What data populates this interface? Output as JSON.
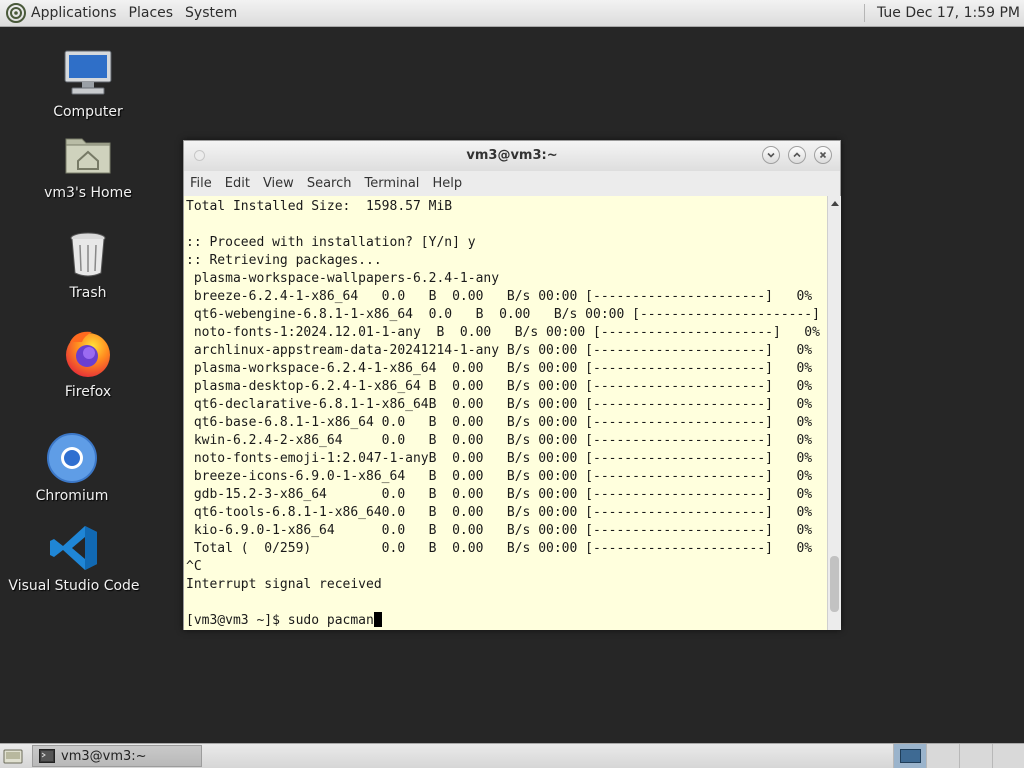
{
  "top_panel": {
    "menus": [
      "Applications",
      "Places",
      "System"
    ],
    "clock": "Tue Dec 17,  1:59 PM"
  },
  "desktop_icons": [
    {
      "label": "Computer",
      "icon": "computer-icon"
    },
    {
      "label": "vm3's Home",
      "icon": "home-folder-icon"
    },
    {
      "label": "Trash",
      "icon": "trash-icon"
    },
    {
      "label": "Firefox",
      "icon": "firefox-icon"
    },
    {
      "label": "Chromium",
      "icon": "chromium-icon"
    },
    {
      "label": "Visual Studio Code",
      "icon": "vscode-icon"
    }
  ],
  "terminal": {
    "title": "vm3@vm3:~",
    "menus": [
      "File",
      "Edit",
      "View",
      "Search",
      "Terminal",
      "Help"
    ],
    "lines": [
      "Total Installed Size:  1598.57 MiB",
      "",
      ":: Proceed with installation? [Y/n] y",
      ":: Retrieving packages...",
      " plasma-workspace-wallpapers-6.2.4-1-any",
      " breeze-6.2.4-1-x86_64   0.0   B  0.00   B/s 00:00 [----------------------]   0%",
      " qt6-webengine-6.8.1-1-x86_64  0.0   B  0.00   B/s 00:00 [----------------------]   0%",
      " noto-fonts-1:2024.12.01-1-any  B  0.00   B/s 00:00 [----------------------]   0%",
      " archlinux-appstream-data-20241214-1-any B/s 00:00 [----------------------]   0%",
      " plasma-workspace-6.2.4-1-x86_64  0.00   B/s 00:00 [----------------------]   0%",
      " plasma-desktop-6.2.4-1-x86_64 B  0.00   B/s 00:00 [----------------------]   0%",
      " qt6-declarative-6.8.1-1-x86_64B  0.00   B/s 00:00 [----------------------]   0%",
      " qt6-base-6.8.1-1-x86_64 0.0   B  0.00   B/s 00:00 [----------------------]   0%",
      " kwin-6.2.4-2-x86_64     0.0   B  0.00   B/s 00:00 [----------------------]   0%",
      " noto-fonts-emoji-1:2.047-1-anyB  0.00   B/s 00:00 [----------------------]   0%",
      " breeze-icons-6.9.0-1-x86_64   B  0.00   B/s 00:00 [----------------------]   0%",
      " gdb-15.2-3-x86_64       0.0   B  0.00   B/s 00:00 [----------------------]   0%",
      " qt6-tools-6.8.1-1-x86_640.0   B  0.00   B/s 00:00 [----------------------]   0%",
      " kio-6.9.0-1-x86_64      0.0   B  0.00   B/s 00:00 [----------------------]   0%",
      " Total (  0/259)         0.0   B  0.00   B/s 00:00 [----------------------]   0%",
      "^C",
      "Interrupt signal received",
      "",
      "[vm3@vm3 ~]$ sudo pacman"
    ]
  },
  "taskbar": {
    "task_label": "vm3@vm3:~"
  }
}
